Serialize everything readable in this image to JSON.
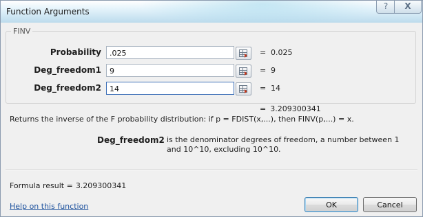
{
  "window": {
    "title": "Function Arguments",
    "help_glyph": "?",
    "close_glyph": "X"
  },
  "function": {
    "name": "FINV",
    "arguments": [
      {
        "label": "Probability",
        "value": ".025",
        "equals": "=",
        "evaluated": "0.025",
        "active": false
      },
      {
        "label": "Deg_freedom1",
        "value": "9",
        "equals": "=",
        "evaluated": "9",
        "active": false
      },
      {
        "label": "Deg_freedom2",
        "value": "14",
        "equals": "=",
        "evaluated": "14",
        "active": true
      }
    ],
    "result_equals": "=",
    "result_value": "3.209300341",
    "description": "Returns the inverse of the F probability distribution: if p = FDIST(x,...), then FINV(p,...) = x.",
    "param_name": "Deg_freedom2",
    "param_description": "is the denominator degrees of freedom, a number between 1 and 10^10, excluding 10^10."
  },
  "footer": {
    "formula_result_label": "Formula result =",
    "formula_result_value": "3.209300341",
    "help_link": "Help on this function",
    "ok_label": "OK",
    "cancel_label": "Cancel"
  },
  "icons": {
    "help": "question-icon",
    "close": "close-icon",
    "ref": "collapse-dialog-icon"
  }
}
